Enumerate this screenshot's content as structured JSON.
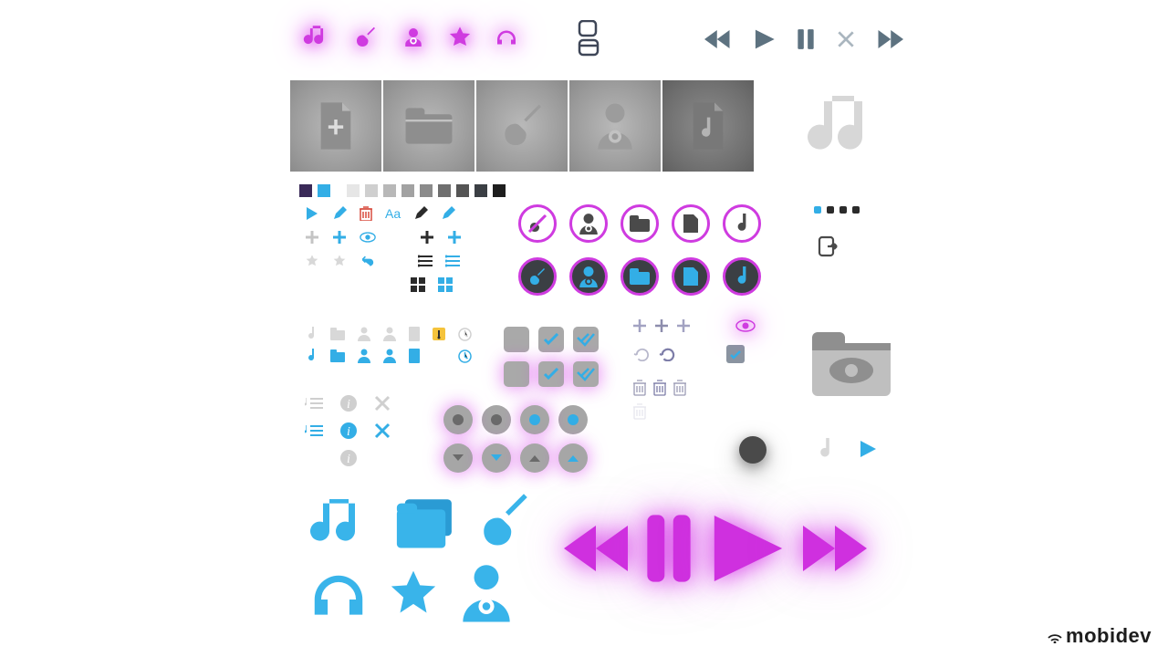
{
  "branding": {
    "label": "mobidev"
  },
  "colors": {
    "pink": "#cf3be0",
    "blue": "#33aee6",
    "slate": "#5d7280",
    "grey": "#b8b8b8",
    "dark": "#3b3f44"
  },
  "top_glow_icons": [
    "music-icon",
    "guitar-icon",
    "artist-icon",
    "star-icon",
    "headphones-icon"
  ],
  "doc_stack_icons": [
    "document-icon",
    "folder-stack-icon"
  ],
  "playback_icons": [
    "rewind-icon",
    "play-icon",
    "pause-icon",
    "close-icon",
    "forward-icon"
  ],
  "grey_tiles": [
    "add-document-icon",
    "folder-icon",
    "guitar-icon",
    "artist-icon",
    "music-file-icon"
  ],
  "large_music_icon": "music-note-icon",
  "palette_dark": [
    "#3a2a58",
    "#33aee6",
    "#e6e6e6",
    "#cfcfcf",
    "#b8b8b8",
    "#a2a2a2",
    "#8b8b8b",
    "#6f6f6f",
    "#555555",
    "#3b3f44",
    "#1e1e1e"
  ],
  "toolbar_rows": {
    "r1": [
      "play-icon",
      "edit-icon",
      "delete-icon",
      "text-icon",
      "edit-icon",
      "edit-icon"
    ],
    "r2": [
      "add-icon",
      "add-icon",
      "eye-icon",
      "add-icon",
      "add-icon"
    ],
    "r3": [
      "star-icon",
      "star-icon",
      "undo-icon",
      "list-icon",
      "list-icon"
    ],
    "r4": [
      "grid-icon",
      "grid-icon"
    ],
    "r5_grey": [
      "music-icon",
      "folder-icon",
      "artist-icon",
      "artist-icon",
      "document-icon",
      "key-icon",
      "clock-icon"
    ],
    "r5_blue": [
      "music-icon",
      "folder-icon",
      "artist-icon",
      "artist-icon",
      "document-icon",
      "clock-icon"
    ],
    "r6_grey": [
      "playlist-icon",
      "info-icon",
      "close-icon"
    ],
    "r6_blue": [
      "playlist-icon",
      "info-icon",
      "close-icon"
    ],
    "r7": [
      "info-icon"
    ]
  },
  "ring_row_light": [
    "no-guitar-icon",
    "artist-icon",
    "folder-icon",
    "document-icon",
    "music-icon"
  ],
  "ring_row_dark": [
    "guitar-icon",
    "artist-icon",
    "folder-icon",
    "document-icon",
    "music-icon"
  ],
  "checkbox_grid": [
    [
      "empty",
      "check",
      "double-check"
    ],
    [
      "empty",
      "check",
      "double-check"
    ]
  ],
  "misc_col": {
    "row1": [
      "add-icon",
      "add-icon",
      "add-icon",
      "eye-icon"
    ],
    "row2": [
      "undo-icon",
      "undo-icon",
      "check-square-icon"
    ],
    "row3": [
      "trash-icon",
      "trash-icon",
      "trash-icon"
    ],
    "row4": [
      "trash-icon"
    ]
  },
  "export_icons": {
    "dots": [
      "blue",
      "dark",
      "dark",
      "dark"
    ],
    "export": "export-icon"
  },
  "folder_eye_icon": "folder-preview-icon",
  "round_buttons": [
    [
      "record-grey",
      "record-grey",
      "record-blue",
      "record-blue"
    ],
    [
      "down-grey",
      "down-blue",
      "up-grey",
      "up-blue"
    ]
  ],
  "small_right": [
    "music-note-grey-icon",
    "play-blue-icon"
  ],
  "big_blue_icons": [
    "music-icon",
    "folders-icon",
    "guitar-icon",
    "headphones-icon",
    "star-icon",
    "artist-icon"
  ],
  "big_pink_playback": [
    "rewind-icon",
    "pause-icon",
    "play-icon",
    "forward-icon"
  ]
}
